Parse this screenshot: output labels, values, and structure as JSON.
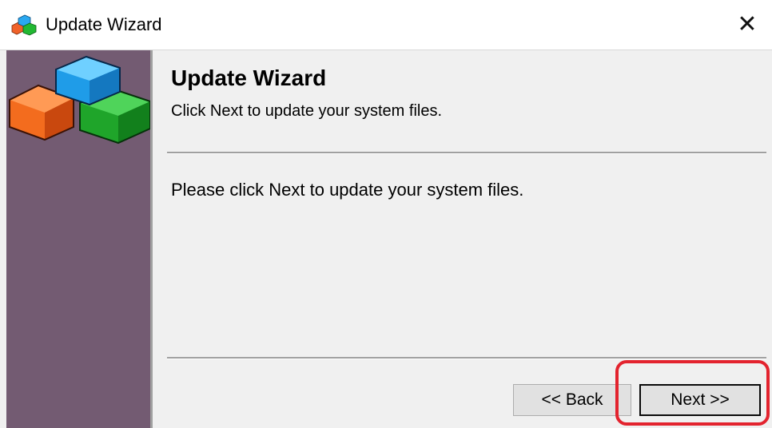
{
  "window": {
    "title": "Update Wizard",
    "app_icon": "colored-blocks-icon",
    "close_glyph": "✕"
  },
  "sidebar": {
    "graphic": "colored-blocks-icon",
    "background_color": "#735b72"
  },
  "content": {
    "heading": "Update Wizard",
    "subheading": "Click Next to update your system files.",
    "body": "Please click Next to update your system files."
  },
  "buttons": {
    "back_label": "<< Back",
    "next_label": "Next >>"
  },
  "highlight": {
    "target": "next-button",
    "color": "#e3232e"
  }
}
